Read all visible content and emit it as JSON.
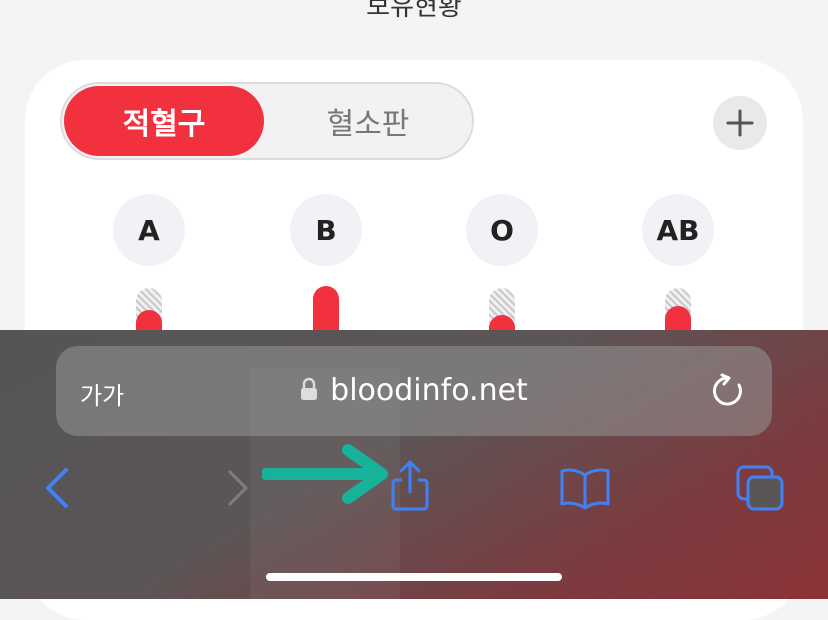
{
  "page": {
    "top_title": "보유현황"
  },
  "card": {
    "segment": {
      "active_label": "적혈구",
      "inactive_label": "혈소판"
    },
    "add_icon": "plus-icon",
    "blood_types": [
      {
        "label": "A",
        "level": 0.45
      },
      {
        "label": "B",
        "level": 1.0
      },
      {
        "label": "O",
        "level": 0.35
      },
      {
        "label": "AB",
        "level": 0.55
      }
    ]
  },
  "browser": {
    "text_size_label": "가가",
    "url": "bloodinfo.net",
    "icons": [
      "lock-icon",
      "reload-icon",
      "back-icon",
      "forward-icon",
      "share-icon",
      "bookmarks-icon",
      "tabs-icon"
    ],
    "accent_color": "#3f82f7",
    "annotation_arrow_color": "#17b29a"
  }
}
